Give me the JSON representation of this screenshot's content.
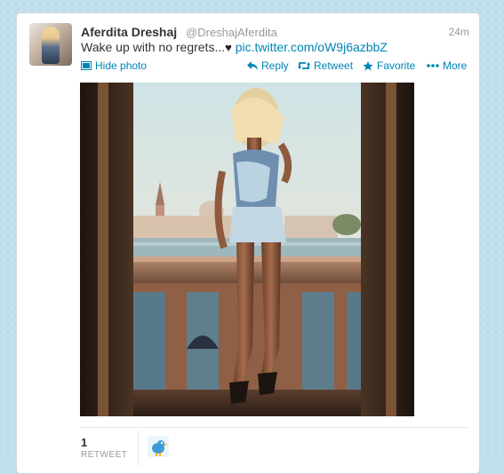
{
  "tweet": {
    "author_name": "Aferdita Dreshaj",
    "author_handle": "@DreshajAferdita",
    "time": "24m",
    "text": "Wake up with no regrets...",
    "heart": "♥",
    "link": "pic.twitter.com/oW9j6azbbZ",
    "avatar_icon": "profile-photo",
    "photo_description_icon": "balcony-photo"
  },
  "actions": {
    "hide_photo": "Hide photo",
    "reply": "Reply",
    "retweet": "Retweet",
    "favorite": "Favorite",
    "more": "More"
  },
  "stats": {
    "retweet_count": "1",
    "retweet_label": "RETWEET"
  },
  "colors": {
    "background": "#c0deed",
    "link": "#0084b4",
    "name": "#333333",
    "muted": "#999999"
  }
}
